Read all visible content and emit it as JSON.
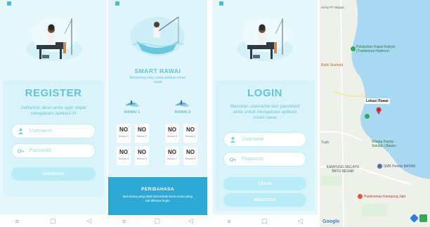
{
  "register": {
    "title": "REGISTER",
    "subtitle": "Daftarkan akun anda agar dapat mengakses aplikasi ini",
    "username_placeholder": "Username",
    "password_placeholder": "Password",
    "register_button": "REGISTER"
  },
  "monitor": {
    "app_title": "SMART RAWAI",
    "app_subtitle": "Monitoring relay pada aplikasi smart rawai",
    "rawai_1": "RAWAI 1",
    "rawai_2": "RAWAI 2",
    "sensors": [
      {
        "status": "NO",
        "name": "Sensor 1"
      },
      {
        "status": "NO",
        "name": "Sensor 2"
      },
      {
        "status": "NO",
        "name": "Sensor 5"
      },
      {
        "status": "NO",
        "name": "Sensor 6"
      },
      {
        "status": "NO",
        "name": "Sensor 3"
      },
      {
        "status": "NO",
        "name": "Sensor 4"
      },
      {
        "status": "NO",
        "name": "Sensor 7"
      },
      {
        "status": "NO",
        "name": "Sensor 8"
      }
    ],
    "peribahasa_title": "PERIBAHASA",
    "peribahasa_text": "laut mana yang tidak berombak bumi mana yang tak ditimpa hujan"
  },
  "login": {
    "title": "LOGIN",
    "subtitle": "Masukan username dan password anda untuk mengakses aplikasi smart rawai",
    "username_placeholder": "Username",
    "password_placeholder": "Password",
    "login_button": "LOGIN",
    "register_button": "REGISTER"
  },
  "map": {
    "top_text": "ed by PT Wijaya",
    "labels": {
      "kapal": "Pelabuhan Kapal Rakyat (Tradisional Harbour)",
      "seafood": "Batik Seafood",
      "lokasi": "Lokasi Rawai",
      "tuah": "Tuah",
      "wisata": "Wisata Pantai Sekilak | Batam",
      "kampung": "KAMPUNG MELAYU BATU BESAR",
      "smk": "SMK Pertiwi BATAM",
      "puskesmas": "Puskesmas Kampung Jabi",
      "google": "Google"
    }
  },
  "nav": {
    "back": "◁",
    "home": "○",
    "recent": "▢",
    "menu": "≡"
  },
  "colors": {
    "accent": "#63c3d8",
    "background": "#e6f8fc",
    "card": "#d8f3fa",
    "button": "#b9ecf6",
    "banner": "#2ea9d6"
  }
}
